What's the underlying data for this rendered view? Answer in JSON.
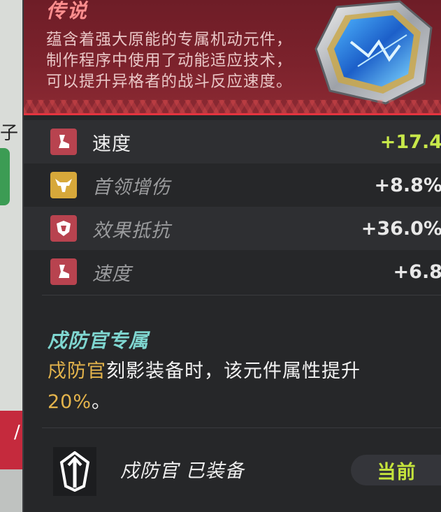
{
  "background": {
    "side_char": "子",
    "red_tab_char": "/"
  },
  "item": {
    "rarity": "传说",
    "description": "蕴含着强大原能的专属机动元件，制作程序中使用了动能适应技术，可以提升异格者的战斗反应速度。"
  },
  "stats": [
    {
      "name": "速度",
      "value": "+17.4",
      "icon": "boot-icon",
      "highlight": true,
      "dim": false
    },
    {
      "name": "首领增伤",
      "value": "+8.8%",
      "icon": "bull-skull-icon",
      "highlight": false,
      "dim": true
    },
    {
      "name": "效果抵抗",
      "value": "+36.0%",
      "icon": "shield-icon",
      "highlight": false,
      "dim": true
    },
    {
      "name": "速度",
      "value": "+6.8",
      "icon": "boot-icon",
      "highlight": false,
      "dim": true
    }
  ],
  "exclusive": {
    "title": "戍防官专属",
    "character": "戍防官",
    "text_rest": "刻影装备时，该元件属性提升",
    "percent": "20%",
    "period": "。"
  },
  "footer": {
    "equipped_text": "戍防官 已装备",
    "current_label": "当前",
    "logo_icon": "arrow-crest-icon"
  },
  "colors": {
    "accent_green": "#c8e84a",
    "accent_cyan": "#7fd6d0",
    "accent_gold": "#e4b44c",
    "rarity_red": "#ff8e8e"
  }
}
